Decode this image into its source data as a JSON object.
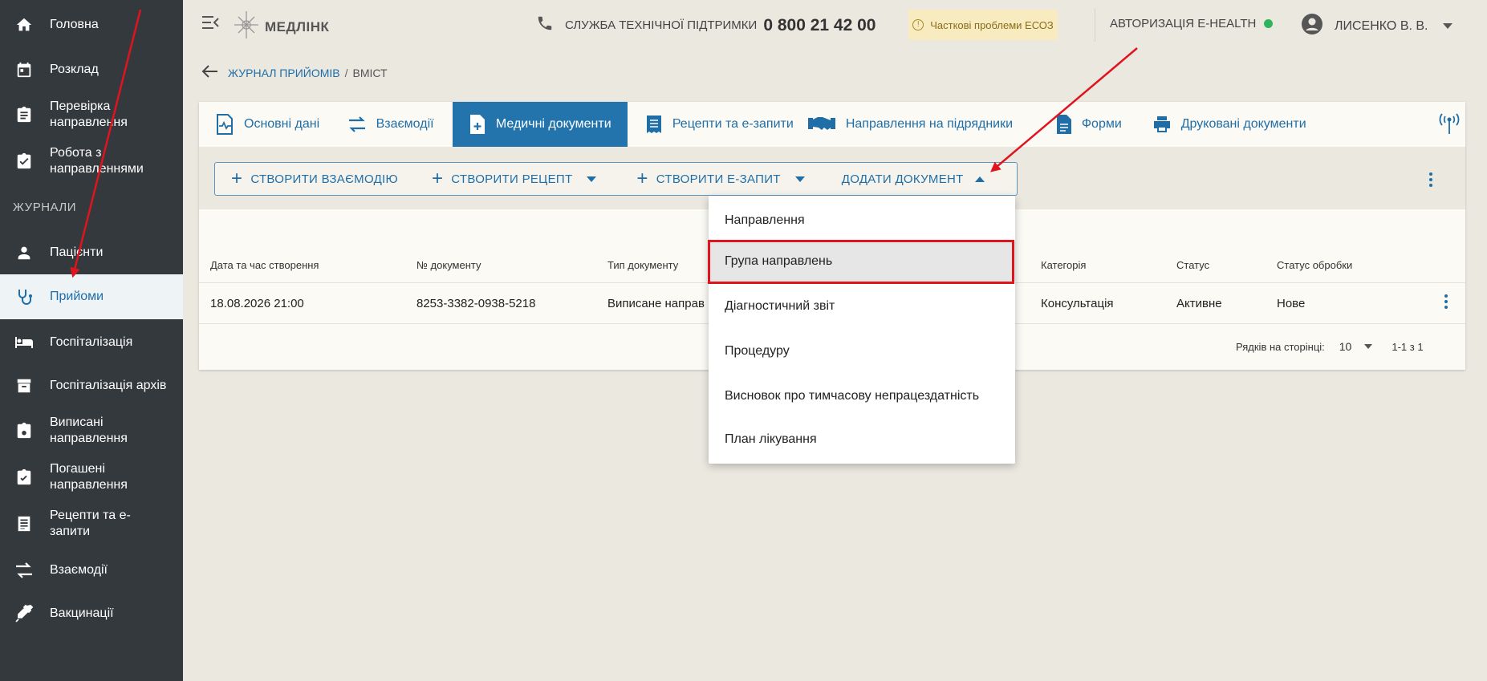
{
  "sidebar": {
    "items": [
      {
        "label": "Головна",
        "icon": "home-icon"
      },
      {
        "label": "Розклад",
        "icon": "calendar-icon"
      },
      {
        "label": "Перевірка направлення",
        "icon": "clipboard-list-icon"
      },
      {
        "label": "Робота з направленнями",
        "icon": "clipboard-check-icon"
      },
      {
        "label": "Пацієнти",
        "icon": "person-icon"
      },
      {
        "label": "Прийоми",
        "icon": "stethoscope-icon"
      },
      {
        "label": "Госпіталізація",
        "icon": "bed-icon"
      },
      {
        "label": "Госпіталізація архів",
        "icon": "archive-icon"
      },
      {
        "label": "Виписані направлення",
        "icon": "clipboard-icon"
      },
      {
        "label": "Погашені направлення",
        "icon": "clipboard-done-icon"
      },
      {
        "label": "Рецепти та е-запити",
        "icon": "list-document-icon"
      },
      {
        "label": "Взаємодії",
        "icon": "swap-arrows-icon"
      },
      {
        "label": "Вакцинації",
        "icon": "syringe-icon"
      }
    ],
    "section_title": "ЖУРНАЛИ",
    "active_label": "Прийоми"
  },
  "topbar": {
    "logo_text": "МЕДЛІНК",
    "support_label": "СЛУЖБА ТЕХНІЧНОЇ ПІДТРИМКИ",
    "support_phone": "0 800 21 42 00",
    "warning": "Часткові проблеми ЕСОЗ",
    "ehealth_label": "АВТОРИЗАЦІЯ E-HEALTH",
    "ehealth_status_color": "#2eb45a",
    "user_name": "ЛИСЕНКО В. В."
  },
  "breadcrumb": {
    "parent": "ЖУРНАЛ ПРИЙОМІВ",
    "separator": "/",
    "current": "ВМІСТ"
  },
  "tabs": [
    {
      "label": "Основні дані",
      "icon": "heart-document-icon"
    },
    {
      "label": "Взаємодії",
      "icon": "swap-arrows-icon"
    },
    {
      "label": "Медичні документи",
      "icon": "add-document-icon",
      "active": true
    },
    {
      "label": "Рецепти та е-запити",
      "icon": "receipt-icon"
    },
    {
      "label": "Направлення на підрядники",
      "icon": "handshake-icon"
    },
    {
      "label": "Форми",
      "icon": "document-icon"
    },
    {
      "label": "Друковані документи",
      "icon": "printer-icon"
    }
  ],
  "toolbar": {
    "create_interaction": "СТВОРИТИ ВЗАЄМОДІЮ",
    "create_recipe": "СТВОРИТИ РЕЦЕПТ",
    "create_erequest": "СТВОРИТИ Е-ЗАПИТ",
    "add_document": "ДОДАТИ ДОКУМЕНТ"
  },
  "table": {
    "headers": [
      "Дата та час створення",
      "№ документу",
      "Тип документу",
      "Категорія",
      "Статус",
      "Статус обробки"
    ],
    "rows": [
      {
        "date": "18.08.2026 21:00",
        "number": "8253-3382-0938-5218",
        "type": "Виписане направ",
        "category": "Консультація",
        "status": "Активне",
        "processing": "Нове"
      }
    ],
    "rows_per_page_label": "Рядків на сторінці:",
    "rows_per_page": "10",
    "range": "1-1 з 1"
  },
  "dropdown": {
    "items": [
      "Направлення",
      "Група направлень",
      "Діагностичний звіт",
      "Процедуру",
      "Висновок про тимчасову непрацездатність",
      "План лікування"
    ],
    "highlighted": "Група направлень"
  },
  "colors": {
    "accent": "#1f6ea8",
    "active_tab": "#2374ad",
    "sidebar_bg": "#34393d",
    "annotation": "#e0141e"
  }
}
